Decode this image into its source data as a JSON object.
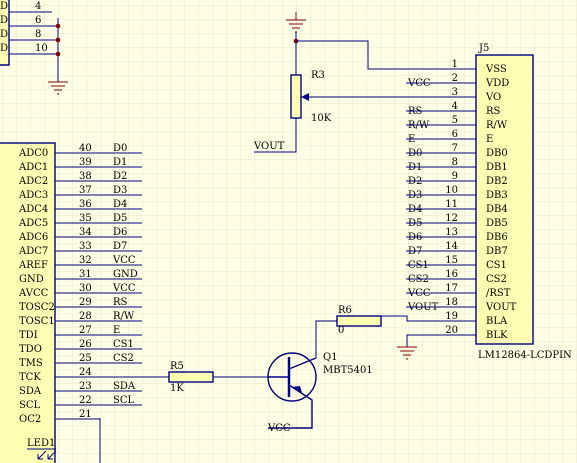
{
  "header_rows": [
    {
      "prefix": "D",
      "pin": "4"
    },
    {
      "prefix": "D",
      "pin": "6"
    },
    {
      "prefix": "D",
      "pin": "8"
    },
    {
      "prefix": "D",
      "pin": "10"
    }
  ],
  "mcu": {
    "pins": [
      {
        "name": "ADC0",
        "num": "40",
        "net": "D0"
      },
      {
        "name": "ADC1",
        "num": "39",
        "net": "D1"
      },
      {
        "name": "ADC2",
        "num": "38",
        "net": "D2"
      },
      {
        "name": "ADC3",
        "num": "37",
        "net": "D3"
      },
      {
        "name": "ADC4",
        "num": "36",
        "net": "D4"
      },
      {
        "name": "ADC5",
        "num": "35",
        "net": "D5"
      },
      {
        "name": "ADC6",
        "num": "34",
        "net": "D6"
      },
      {
        "name": "ADC7",
        "num": "33",
        "net": "D7"
      },
      {
        "name": "AREF",
        "num": "32",
        "net": "VCC"
      },
      {
        "name": "GND",
        "num": "31",
        "net": "GND"
      },
      {
        "name": "AVCC",
        "num": "30",
        "net": "VCC"
      },
      {
        "name": "TOSC2",
        "num": "29",
        "net": "RS"
      },
      {
        "name": "TOSC1",
        "num": "28",
        "net": "R/W"
      },
      {
        "name": "TDI",
        "num": "27",
        "net": "E"
      },
      {
        "name": "TDO",
        "num": "26",
        "net": "CS1"
      },
      {
        "name": "TMS",
        "num": "25",
        "net": "CS2"
      },
      {
        "name": "TCK",
        "num": "24",
        "net": ""
      },
      {
        "name": "SDA",
        "num": "23",
        "net": "SDA"
      },
      {
        "name": "SCL",
        "num": "22",
        "net": "SCL"
      },
      {
        "name": "OC2",
        "num": "21",
        "net": ""
      }
    ]
  },
  "lcd": {
    "designator": "J5",
    "part_name": "LM12864-LCDPIN",
    "pins": [
      {
        "num": "1",
        "name": "VSS",
        "net": ""
      },
      {
        "num": "2",
        "name": "VDD",
        "net": "VCC"
      },
      {
        "num": "3",
        "name": "VO",
        "net": ""
      },
      {
        "num": "4",
        "name": "RS",
        "net": "RS"
      },
      {
        "num": "5",
        "name": "R/W",
        "net": "R/W"
      },
      {
        "num": "6",
        "name": "E",
        "net": "E"
      },
      {
        "num": "7",
        "name": "DB0",
        "net": "D0"
      },
      {
        "num": "8",
        "name": "DB1",
        "net": "D1"
      },
      {
        "num": "9",
        "name": "DB2",
        "net": "D2"
      },
      {
        "num": "10",
        "name": "DB3",
        "net": "D3"
      },
      {
        "num": "11",
        "name": "DB4",
        "net": "D4"
      },
      {
        "num": "12",
        "name": "DB5",
        "net": "D5"
      },
      {
        "num": "13",
        "name": "DB6",
        "net": "D6"
      },
      {
        "num": "14",
        "name": "DB7",
        "net": "D7"
      },
      {
        "num": "15",
        "name": "CS1",
        "net": "CS1"
      },
      {
        "num": "16",
        "name": "CS2",
        "net": "CS2"
      },
      {
        "num": "17",
        "name": "/RST",
        "net": "VCC"
      },
      {
        "num": "18",
        "name": "VOUT",
        "net": "VOUT"
      },
      {
        "num": "19",
        "name": "BLA",
        "net": ""
      },
      {
        "num": "20",
        "name": "BLK",
        "net": ""
      }
    ]
  },
  "r3": {
    "designator": "R3",
    "value": "10K",
    "net": "VOUT"
  },
  "r5": {
    "designator": "R5",
    "value": "1K"
  },
  "r6": {
    "designator": "R6",
    "value": "0"
  },
  "q1": {
    "designator": "Q1",
    "part": "MBT5401",
    "emitter_net": "VCC"
  },
  "led": {
    "designator": "LED1"
  },
  "colors": {
    "background": "#ffffe6",
    "grid": "#d2d2b4",
    "wire": "#000080",
    "component_fill": "#ffffb4",
    "junction": "#800000",
    "text": "#000000"
  }
}
